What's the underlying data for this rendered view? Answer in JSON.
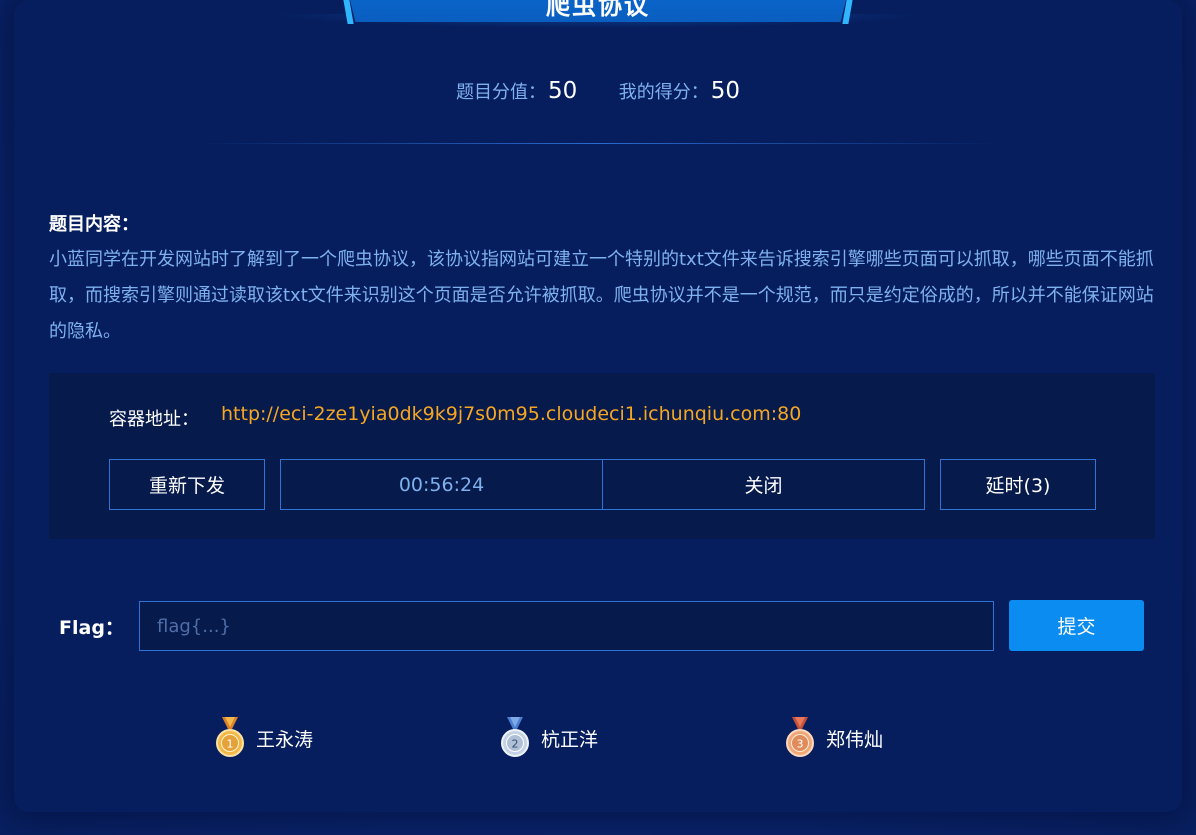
{
  "challenge": {
    "title": "爬虫协议",
    "score_label": "题目分值：",
    "score_value": "50",
    "my_score_label": "我的得分：",
    "my_score_value": "50"
  },
  "content": {
    "label": "题目内容：",
    "text": "小蓝同学在开发网站时了解到了一个爬虫协议，该协议指网站可建立一个特别的txt文件来告诉搜索引擎哪些页面可以抓取，哪些页面不能抓取，而搜索引擎则通过读取该txt文件来识别这个页面是否允许被抓取。爬虫协议并不是一个规范，而只是约定俗成的，所以并不能保证网站的隐私。"
  },
  "container": {
    "address_label": "容器地址：",
    "address_value": "http://eci-2ze1yia0dk9k9j7s0m95.cloudeci1.ichunqiu.com:80",
    "reissue_label": "重新下发",
    "timer": "00:56:24",
    "close_label": "关闭",
    "extend_label": "延时(3)"
  },
  "flag": {
    "label": "Flag：",
    "placeholder": "flag{...}",
    "value": "",
    "submit_label": "提交"
  },
  "ranking": [
    {
      "rank": "1",
      "name": "王永涛",
      "medal": "gold-medal-icon"
    },
    {
      "rank": "2",
      "name": "杭正洋",
      "medal": "silver-medal-icon"
    },
    {
      "rank": "3",
      "name": "郑伟灿",
      "medal": "bronze-medal-icon"
    }
  ],
  "colors": {
    "background": "#0a2a7a",
    "panel": "#061e5e",
    "accent_blue": "#0a8cf0",
    "border_blue": "#2f73d6",
    "address_orange": "#f5a623",
    "muted_text": "#7fb1ee",
    "gold": "#f2b94a",
    "silver": "#aebfd6",
    "bronze": "#e08c5a"
  }
}
